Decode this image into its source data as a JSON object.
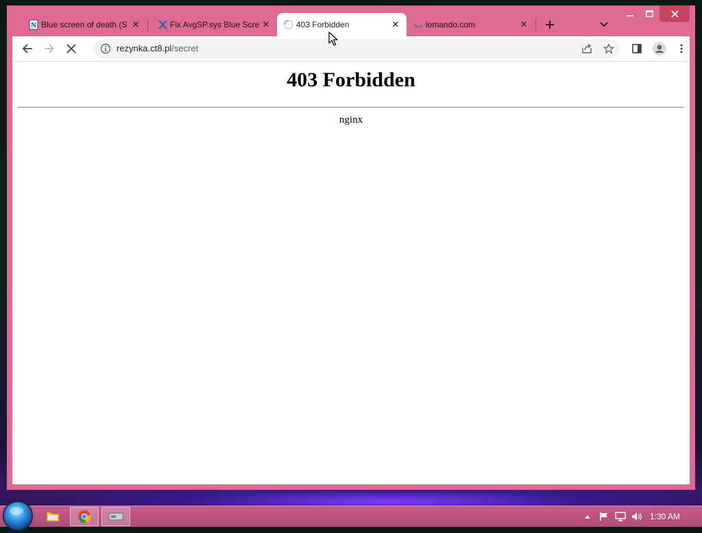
{
  "browser": {
    "tabs": [
      {
        "title": "Blue screen of death (S",
        "favicon": "document-n-icon",
        "active": false
      },
      {
        "title": "Fix AvgSP.sys Blue Scre",
        "favicon": "x-logo-icon",
        "active": false
      },
      {
        "title": "403 Forbidden",
        "favicon": "loading-spinner-icon",
        "active": true
      },
      {
        "title": "lomando.com",
        "favicon": "loading-spinner-icon",
        "active": false
      }
    ],
    "address": {
      "host": "rezynka.ct8.pl",
      "path": "/secret"
    }
  },
  "page": {
    "heading": "403 Forbidden",
    "server": "nginx"
  },
  "taskbar": {
    "clock": "1:30 AM"
  },
  "colors": {
    "window_frame": "#dc6a92",
    "taskbar": "#c85a88",
    "close_button": "#c8455f"
  }
}
